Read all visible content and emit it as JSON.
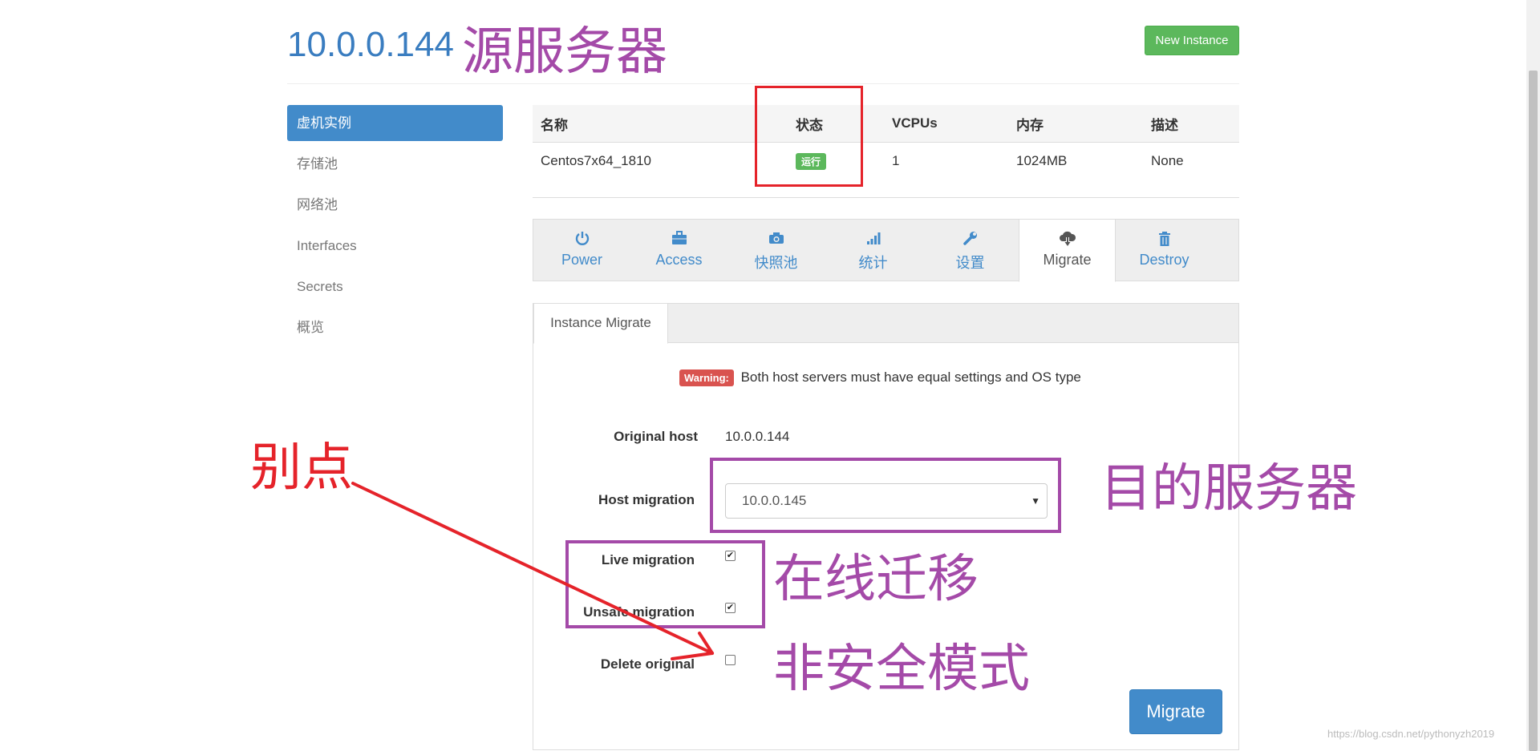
{
  "header": {
    "host_title": "10.0.0.144",
    "new_instance_label": "New Instance"
  },
  "sidebar": {
    "items": [
      {
        "label": "虚机实例",
        "active": true
      },
      {
        "label": "存储池"
      },
      {
        "label": "网络池"
      },
      {
        "label": "Interfaces"
      },
      {
        "label": "Secrets"
      },
      {
        "label": "概览"
      }
    ]
  },
  "instances": {
    "headers": [
      "名称",
      "状态",
      "VCPUs",
      "内存",
      "描述"
    ],
    "rows": [
      {
        "name": "Centos7x64_1810",
        "status": "运行",
        "vcpus": "1",
        "memory": "1024MB",
        "description": "None"
      }
    ]
  },
  "action_tabs": [
    {
      "label": "Power",
      "icon": "power-icon"
    },
    {
      "label": "Access",
      "icon": "briefcase-icon"
    },
    {
      "label": "快照池",
      "icon": "camera-icon"
    },
    {
      "label": "统计",
      "icon": "signal-icon"
    },
    {
      "label": "设置",
      "icon": "wrench-icon"
    },
    {
      "label": "Migrate",
      "icon": "cloud-download-icon",
      "active": true
    },
    {
      "label": "Destroy",
      "icon": "trash-icon"
    }
  ],
  "migrate": {
    "subtab": "Instance Migrate",
    "warning_label": "Warning:",
    "warning_text": "Both host servers must have equal settings and OS type",
    "original_host_label": "Original host",
    "original_host_value": "10.0.0.144",
    "host_migration_label": "Host migration",
    "host_migration_value": "10.0.0.145",
    "live_label": "Live migration",
    "live_checked": true,
    "unsafe_label": "Unsafe migration",
    "unsafe_checked": true,
    "delete_label": "Delete original",
    "delete_checked": false,
    "submit_label": "Migrate"
  },
  "annotations": {
    "source_server": "源服务器",
    "target_server": "目的服务器",
    "online_migration": "在线迁移",
    "unsafe_mode": "非安全模式",
    "dont_click": "别点"
  },
  "colors": {
    "accent": "#428bca",
    "success": "#5cb85c",
    "danger": "#d9534f",
    "annotation_red": "#e5232a",
    "annotation_purple": "#a44aa8"
  },
  "watermark": "https://blog.csdn.net/pythonyzh2019"
}
